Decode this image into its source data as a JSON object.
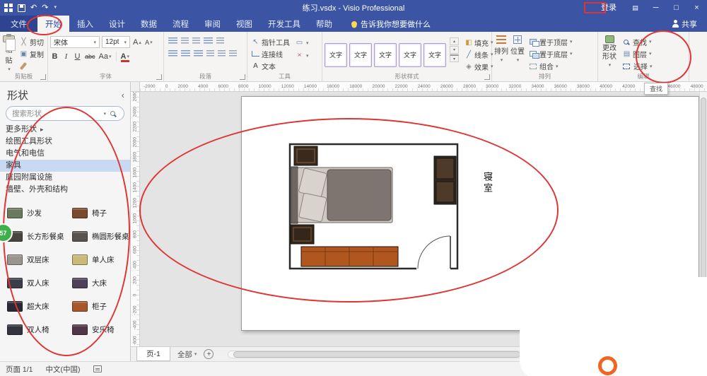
{
  "colors": {
    "titlebar": "#3b55a4",
    "annotation": "#e03434",
    "selected_category": "#c8daf2"
  },
  "titlebar": {
    "title": "练习.vsdx - Visio Professional",
    "signin_label": "登录",
    "window_buttons": {
      "minimize": "─",
      "restore": "□",
      "close": "×"
    }
  },
  "tab_strip": {
    "file_tab": "文件",
    "tabs": [
      "开始",
      "插入",
      "设计",
      "数据",
      "流程",
      "审阅",
      "视图",
      "开发工具",
      "帮助"
    ],
    "active_tab": "开始",
    "tellme_placeholder": "告诉我你想要做什么",
    "share_label": "共享"
  },
  "ribbon": {
    "clipboard": {
      "group_label": "剪贴板",
      "paste": "粘贴",
      "cut": "剪切",
      "copy": "复制",
      "format_painter": "格式刷"
    },
    "font": {
      "group_label": "字体",
      "font_name": "宋体",
      "font_size": "12pt",
      "bold": "B",
      "italic": "I",
      "underline": "U",
      "strikethrough": "abc",
      "case_toggle": "Aa",
      "font_color": "A"
    },
    "paragraph": {
      "group_label": "段落"
    },
    "tools": {
      "group_label": "工具",
      "pointer": "指针工具",
      "connector": "连接线",
      "text": "文本"
    },
    "shape_styles": {
      "group_label": "形状样式",
      "preview_label": "文字",
      "preview_count": 5,
      "fill": "填充",
      "line": "线条",
      "effects": "效果"
    },
    "arrange": {
      "group_label": "排列",
      "align": "排列",
      "position": "位置",
      "bring_to_front": "置于顶层",
      "send_to_back": "置于底层",
      "group": "组合"
    },
    "editing": {
      "group_label": "编辑",
      "change_shape": "更改形状",
      "find": "查找",
      "layers": "图层",
      "select": "选择"
    },
    "find_tooltip": "查找"
  },
  "shapes_panel": {
    "title": "形状",
    "search_placeholder": "搜索形状",
    "categories": [
      {
        "label": "更多形状",
        "expander": "▸"
      },
      {
        "label": "绘图工具形状"
      },
      {
        "label": "电气和电信"
      },
      {
        "label": "家具",
        "selected": true
      },
      {
        "label": "庭园附属设施"
      },
      {
        "label": "墙壁、外壳和结构"
      }
    ],
    "stencil_shapes": [
      {
        "label": "沙发",
        "color": "#6b7a5e"
      },
      {
        "label": "椅子",
        "color": "#7a4a2a"
      },
      {
        "label": "长方形餐桌",
        "color": "#4a4440"
      },
      {
        "label": "椭圆形餐桌",
        "color": "#5a5450"
      },
      {
        "label": "双层床",
        "color": "#9a948e"
      },
      {
        "label": "单人床",
        "color": "#c9b97a"
      },
      {
        "label": "双人床",
        "color": "#3a3e48"
      },
      {
        "label": "大床",
        "color": "#4e4258"
      },
      {
        "label": "超大床",
        "color": "#2a2c34"
      },
      {
        "label": "柜子",
        "color": "#a8562b"
      },
      {
        "label": "双人椅",
        "color": "#34343e"
      },
      {
        "label": "安乐椅",
        "color": "#503646"
      }
    ]
  },
  "rulers": {
    "horizontal": [
      -2000,
      0,
      2000,
      4000,
      6000,
      8000,
      10000,
      12000,
      14000,
      16000,
      18000,
      20000,
      22000,
      24000,
      26000,
      28000,
      30000,
      32000,
      34000,
      36000,
      38000,
      40000,
      42000,
      44000,
      46000,
      48000
    ],
    "vertical": [
      2600,
      2400,
      2200,
      2000,
      1800,
      1600,
      1400,
      1200,
      1000,
      800,
      600,
      400,
      200,
      0,
      -200,
      -400,
      -600
    ]
  },
  "drawing": {
    "room_label": "寝室"
  },
  "page_bar": {
    "page_tab": "页-1",
    "all_pages": "全部"
  },
  "status_bar": {
    "page_info": "页面 1/1",
    "language": "中文(中国)"
  },
  "floating_badge": {
    "count": "57"
  },
  "icons": {
    "undo": "↶",
    "redo": "↷",
    "dropdown": "▾",
    "up": "▴",
    "down": "▾",
    "expander": "▸",
    "chevron_left": "‹",
    "rect": "▭",
    "multiply": "×",
    "plus": "+",
    "pointer": "↖",
    "letterA": "A",
    "copy": "▣",
    "cut": "╳",
    "layers": "▤",
    "fill": "◧",
    "line": "╱",
    "effects": "◈"
  }
}
